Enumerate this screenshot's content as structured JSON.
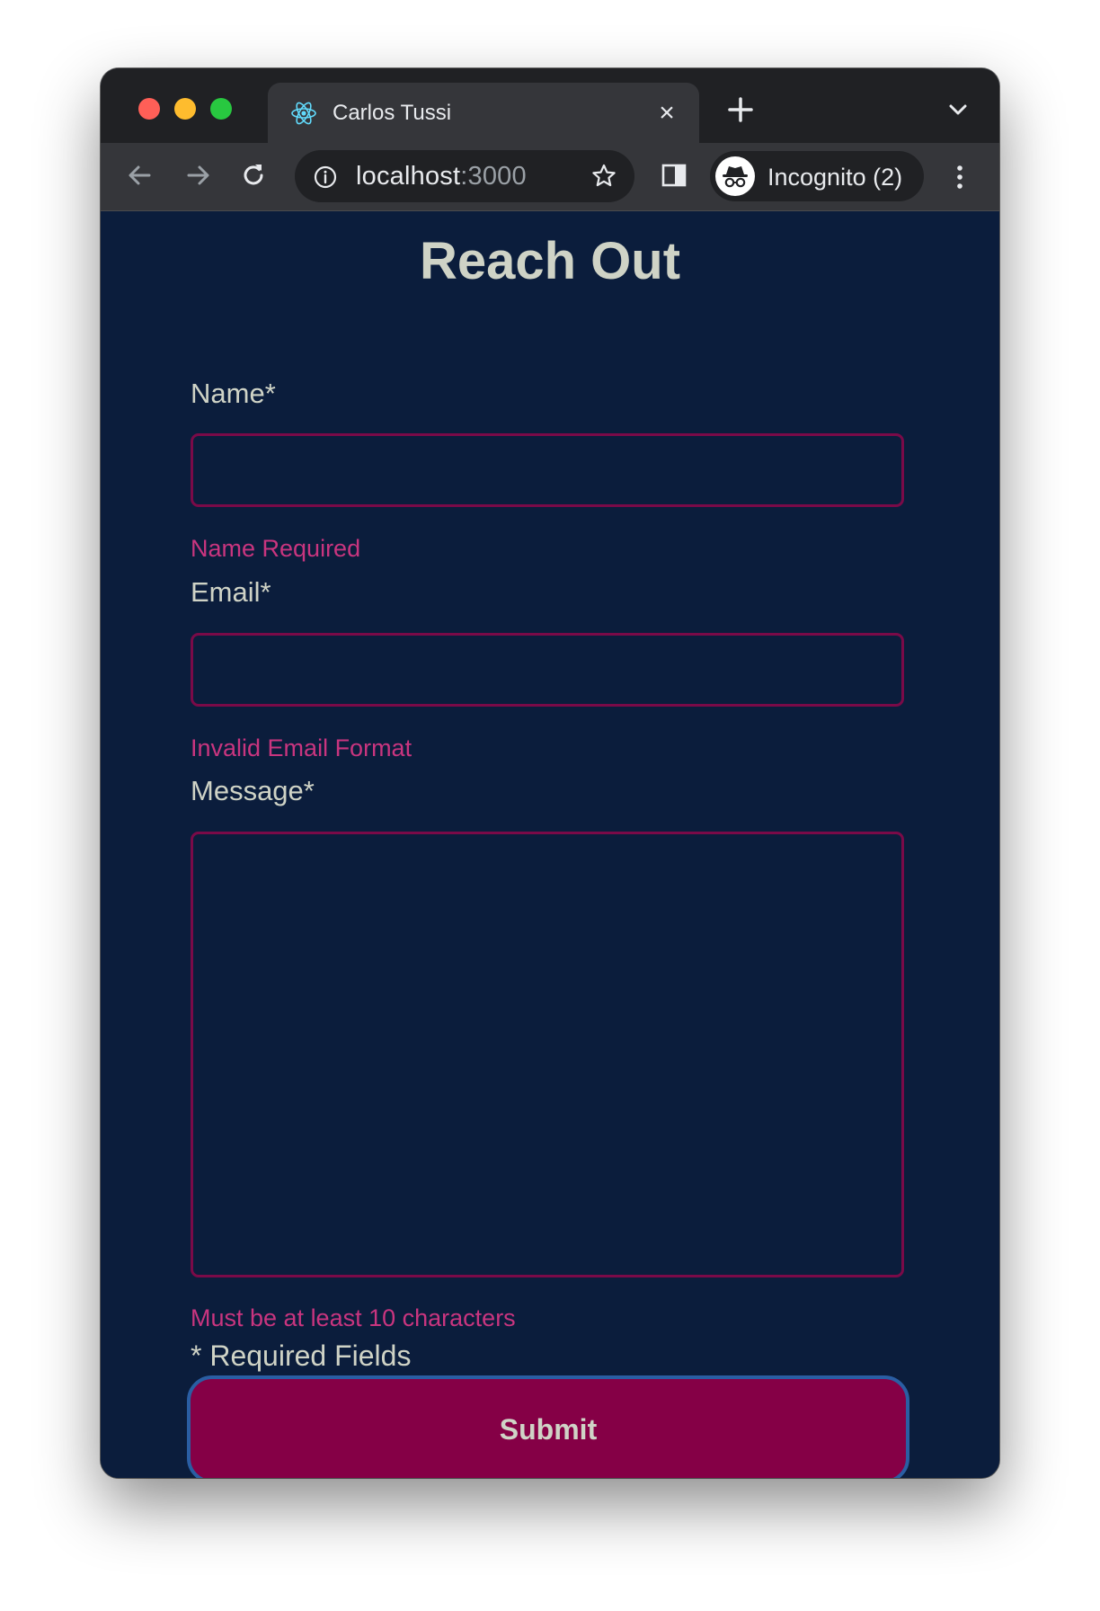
{
  "browser": {
    "tab": {
      "title": "Carlos Tussi",
      "favicon": "react-logo-icon",
      "close_label": "×"
    },
    "new_tab_icon": "plus-icon",
    "tab_list_icon": "chevron-down-icon",
    "omnibox": {
      "host": "localhost",
      "port": ":3000",
      "info_icon": "info-icon",
      "bookmark_icon": "star-icon"
    },
    "incognito": {
      "label": "Incognito (2)",
      "icon": "incognito-icon"
    }
  },
  "page": {
    "title": "Reach Out",
    "fields": [
      {
        "label": "Name*",
        "value": "",
        "error": "Name Required"
      },
      {
        "label": "Email*",
        "value": "",
        "error": "Invalid Email Format"
      },
      {
        "label": "Message*",
        "value": "",
        "error": "Must be at least 10 characters"
      }
    ],
    "required_note": "* Required Fields",
    "submit_label": "Submit"
  },
  "colors": {
    "page_background": "#0b1d3c",
    "text": "#cfd3c6",
    "error": "#c9357f",
    "input_border": "#7a0a48",
    "submit_background": "#850046",
    "submit_border": "#2a5ea3"
  }
}
